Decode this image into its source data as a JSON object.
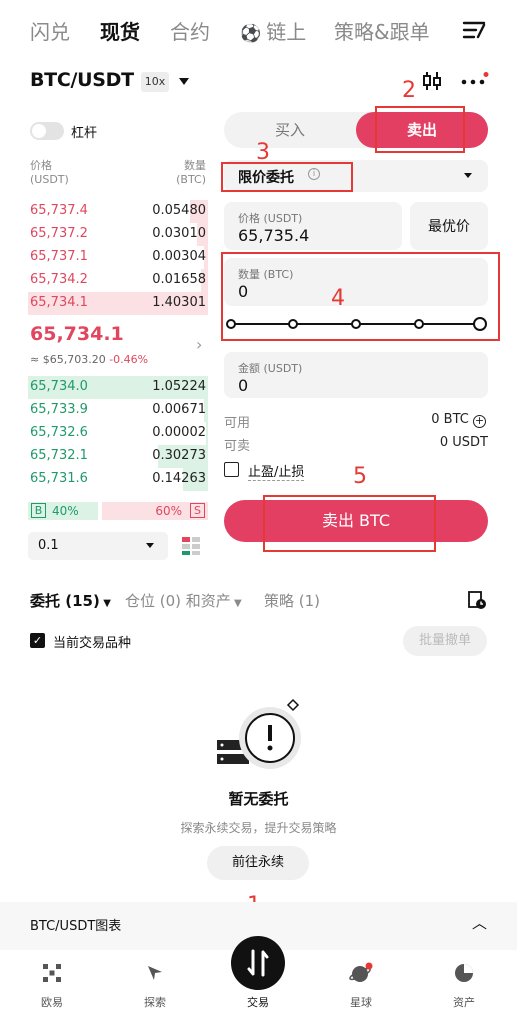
{
  "top_tabs": [
    "闪兑",
    "现货",
    "合约",
    "链上",
    "策略&跟单"
  ],
  "header": {
    "pair": "BTC/USDT",
    "leverage": "10x"
  },
  "leverage_toggle": {
    "label": "杠杆"
  },
  "orderbook": {
    "price_header": "价格",
    "price_unit": "(USDT)",
    "qty_header": "数量",
    "qty_unit": "(BTC)",
    "asks": [
      {
        "price": "65,737.4",
        "qty": "0.05480",
        "depth": 0.1
      },
      {
        "price": "65,737.2",
        "qty": "0.03010",
        "depth": 0.06
      },
      {
        "price": "65,737.1",
        "qty": "0.00304",
        "depth": 0.02
      },
      {
        "price": "65,734.2",
        "qty": "0.01658",
        "depth": 0.04
      },
      {
        "price": "65,734.1",
        "qty": "1.40301",
        "depth": 1.0
      }
    ],
    "last_price": "65,734.1",
    "ref_price": "≈ $65,703.20",
    "change": "-0.46%",
    "bids": [
      {
        "price": "65,734.0",
        "qty": "1.05224",
        "depth": 1.0
      },
      {
        "price": "65,733.9",
        "qty": "0.00671",
        "depth": 0.02
      },
      {
        "price": "65,732.6",
        "qty": "0.00002",
        "depth": 0.01
      },
      {
        "price": "65,732.1",
        "qty": "0.30273",
        "depth": 0.28
      },
      {
        "price": "65,731.6",
        "qty": "0.14263",
        "depth": 0.14
      }
    ],
    "buy_badge": "B",
    "buy_pct": "40%",
    "sell_pct": "60%",
    "sell_badge": "S",
    "buy_ratio": 0.4,
    "precision": "0.1"
  },
  "form": {
    "buy_label": "买入",
    "sell_label": "卖出",
    "order_type": "限价委托",
    "price_label": "价格 (USDT)",
    "price_value": "65,735.4",
    "best_price": "最优价",
    "qty_label": "数量 (BTC)",
    "qty_value": "0",
    "amount_label": "金额 (USDT)",
    "amount_value": "0",
    "available_label": "可用",
    "available_value": "0 BTC",
    "sellable_label": "可卖",
    "sellable_value": "0 USDT",
    "tpsl_label": "止盈/止损",
    "submit_label": "卖出 BTC"
  },
  "annotations": [
    "1",
    "2",
    "3",
    "4",
    "5"
  ],
  "orders": {
    "tab_orders": "委托 (15)",
    "tab_positions": "仓位 (0) 和资产",
    "tab_strategy": "策略 (1)",
    "current_pair_only": "当前交易品种",
    "batch_cancel": "批量撤单",
    "empty_title": "暂无委托",
    "empty_sub": "探索永续交易，提升交易策略",
    "goto_perp": "前往永续"
  },
  "chart_bar": {
    "title": "BTC/USDT图表"
  },
  "bottom_nav": [
    "欧易",
    "探索",
    "交易",
    "星球",
    "资产"
  ],
  "colors": {
    "sell": "#e23f63",
    "ask": "#e0475f",
    "bid": "#1f9a6a",
    "annotation": "#e53935"
  }
}
